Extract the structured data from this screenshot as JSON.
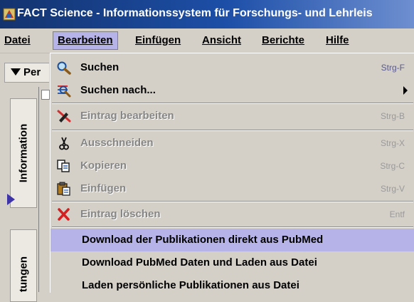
{
  "window": {
    "title": "FACT Science - Informationssystem für Forschungs- und Lehrleis"
  },
  "menubar": [
    {
      "label": "Datei",
      "active": false
    },
    {
      "label": "Bearbeiten",
      "active": true
    },
    {
      "label": "Einfügen",
      "active": false
    },
    {
      "label": "Ansicht",
      "active": false
    },
    {
      "label": "Berichte",
      "active": false
    },
    {
      "label": "Hilfe",
      "active": false
    }
  ],
  "toolbar": {
    "dropdown_label": "Per"
  },
  "side_tabs": {
    "information": "Information",
    "second": "tungen"
  },
  "edit_menu": {
    "items": [
      {
        "label": "Suchen",
        "shortcut": "Strg-F",
        "enabled": true,
        "icon": "search-icon"
      },
      {
        "label": "Suchen nach...",
        "shortcut": "",
        "enabled": true,
        "icon": "search-list-icon",
        "submenu": true
      },
      {
        "label": "Eintrag bearbeiten",
        "shortcut": "Strg-B",
        "enabled": false,
        "icon": "edit-pencil-icon"
      },
      {
        "label": "Ausschneiden",
        "shortcut": "Strg-X",
        "enabled": false,
        "icon": "scissors-icon"
      },
      {
        "label": "Kopieren",
        "shortcut": "Strg-C",
        "enabled": false,
        "icon": "copy-icon"
      },
      {
        "label": "Einfügen",
        "shortcut": "Strg-V",
        "enabled": false,
        "icon": "paste-icon"
      },
      {
        "label": "Eintrag löschen",
        "shortcut": "Entf",
        "enabled": false,
        "icon": "delete-x-icon"
      },
      {
        "label": "Download der Publikationen direkt aus PubMed",
        "shortcut": "",
        "enabled": true,
        "highlighted": true
      },
      {
        "label": "Download PubMed Daten und Laden aus Datei",
        "shortcut": "",
        "enabled": true
      },
      {
        "label": "Laden persönliche Publikationen aus Datei",
        "shortcut": "",
        "enabled": true
      }
    ]
  },
  "colors": {
    "highlight": "#b6b3e8",
    "titlebar": "#13336e",
    "disabled_text": "#868686",
    "accent_arrow": "#3f33a8"
  }
}
